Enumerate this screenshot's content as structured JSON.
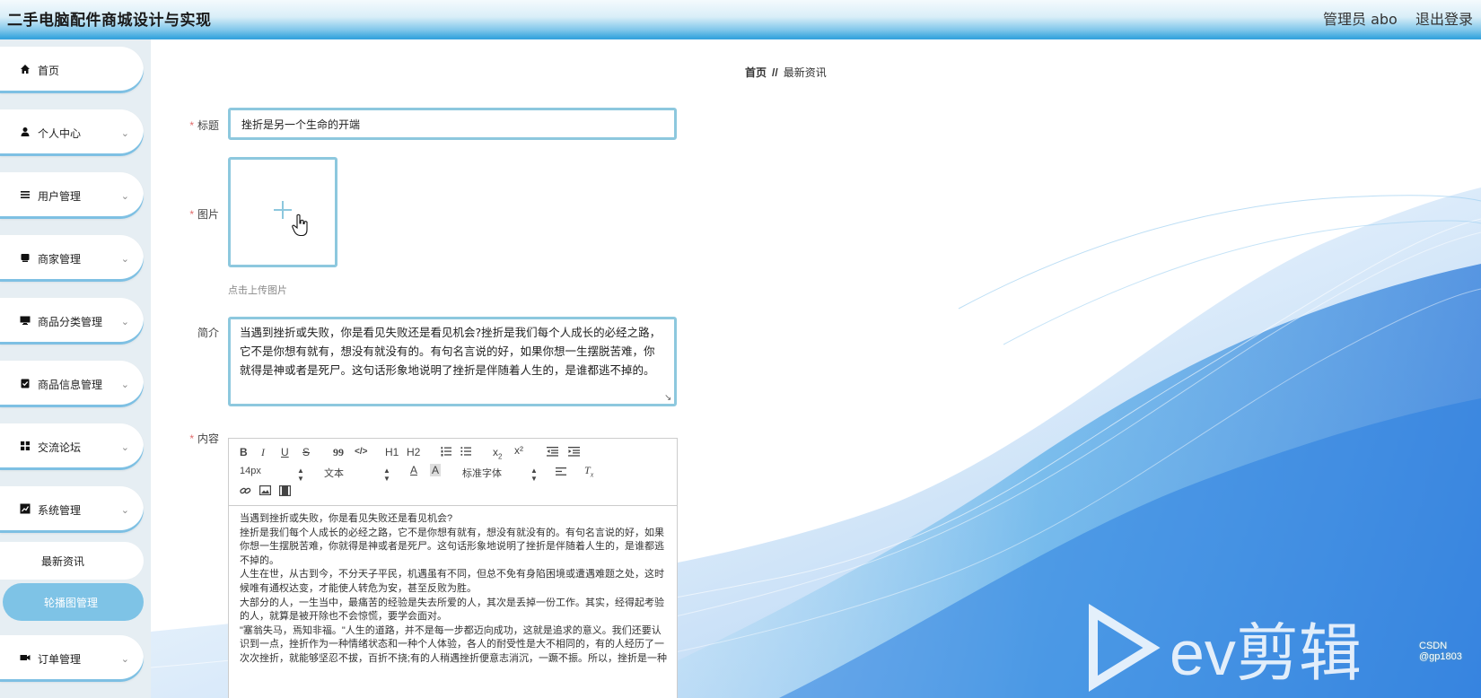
{
  "header": {
    "app_title": "二手电脑配件商城设计与实现",
    "admin_label": "管理员 abo",
    "logout_label": "退出登录"
  },
  "sidebar": {
    "items": [
      {
        "label": "首页",
        "icon": "home-icon",
        "has_arrow": false
      },
      {
        "label": "个人中心",
        "icon": "user-icon",
        "has_arrow": true
      },
      {
        "label": "用户管理",
        "icon": "list-icon",
        "has_arrow": true
      },
      {
        "label": "商家管理",
        "icon": "store-icon",
        "has_arrow": true
      },
      {
        "label": "商品分类管理",
        "icon": "monitor-icon",
        "has_arrow": true
      },
      {
        "label": "商品信息管理",
        "icon": "clipboard-check-icon",
        "has_arrow": true
      },
      {
        "label": "交流论坛",
        "icon": "grid-icon",
        "has_arrow": true
      },
      {
        "label": "系统管理",
        "icon": "chart-icon",
        "has_arrow": true
      }
    ],
    "sub_items": [
      {
        "label": "最新资讯",
        "active": false
      },
      {
        "label": "轮播图管理",
        "active": true
      }
    ],
    "bottom_item": {
      "label": "订单管理",
      "icon": "video-icon",
      "has_arrow": true
    }
  },
  "breadcrumb": {
    "home": "首页",
    "separator": "//",
    "current": "最新资讯"
  },
  "form": {
    "title_label": "标题",
    "title_value": "挫折是另一个生命的开端",
    "image_label": "图片",
    "upload_hint": "点击上传图片",
    "intro_label": "简介",
    "intro_value": "当遇到挫折或失败，你是看见失败还是看见机会?挫折是我们每个人成长的必经之路，它不是你想有就有，想没有就没有的。有句名言说的好，如果你想一生摆脱苦难，你就得是神或者是死尸。这句话形象地说明了挫折是伴随着人生的，是谁都逃不掉的。",
    "content_label": "内容",
    "required_mark": "*"
  },
  "editor": {
    "toolbar_row1": [
      "B",
      "I",
      "U",
      "S",
      "99",
      "</>",
      "H1",
      "H2",
      "ol",
      "ul",
      "x2",
      "x²",
      "outdent",
      "indent"
    ],
    "font_size": "14px",
    "paragraph": "文本",
    "font_family": "标准字体",
    "content": "当遇到挫折或失败，你是看见失败还是看见机会?\n挫折是我们每个人成长的必经之路，它不是你想有就有，想没有就没有的。有句名言说的好，如果你想一生摆脱苦难，你就得是神或者是死尸。这句话形象地说明了挫折是伴随着人生的，是谁都逃不掉的。\n人生在世，从古到今，不分天子平民，机遇虽有不同，但总不免有身陷困境或遭遇难题之处，这时候唯有通权达变，才能使人转危为安，甚至反败为胜。\n大部分的人，一生当中，最痛苦的经验是失去所爱的人，其次是丢掉一份工作。其实，经得起考验的人，就算是被开除也不会惊慌，要学会面对。\n\"塞翁失马，焉知非福。\"人生的道路，并不是每一步都迈向成功，这就是追求的意义。我们还要认识到一点，挫折作为一种情绪状态和一种个人体验，各人的耐受性是大不相同的，有的人经历了一次次挫折，就能够坚忍不拔，百折不挠;有的人稍遇挫折便意志消沉，一蹶不振。所以，挫折是一种"
  },
  "watermark": {
    "csdn": "CSDN @gp1803",
    "ev": "ev剪辑"
  },
  "colors": {
    "accent": "#8dc8de",
    "header_blue": "#39a4dd",
    "active_sub": "#7ec3e6",
    "required": "#e06c6c"
  }
}
